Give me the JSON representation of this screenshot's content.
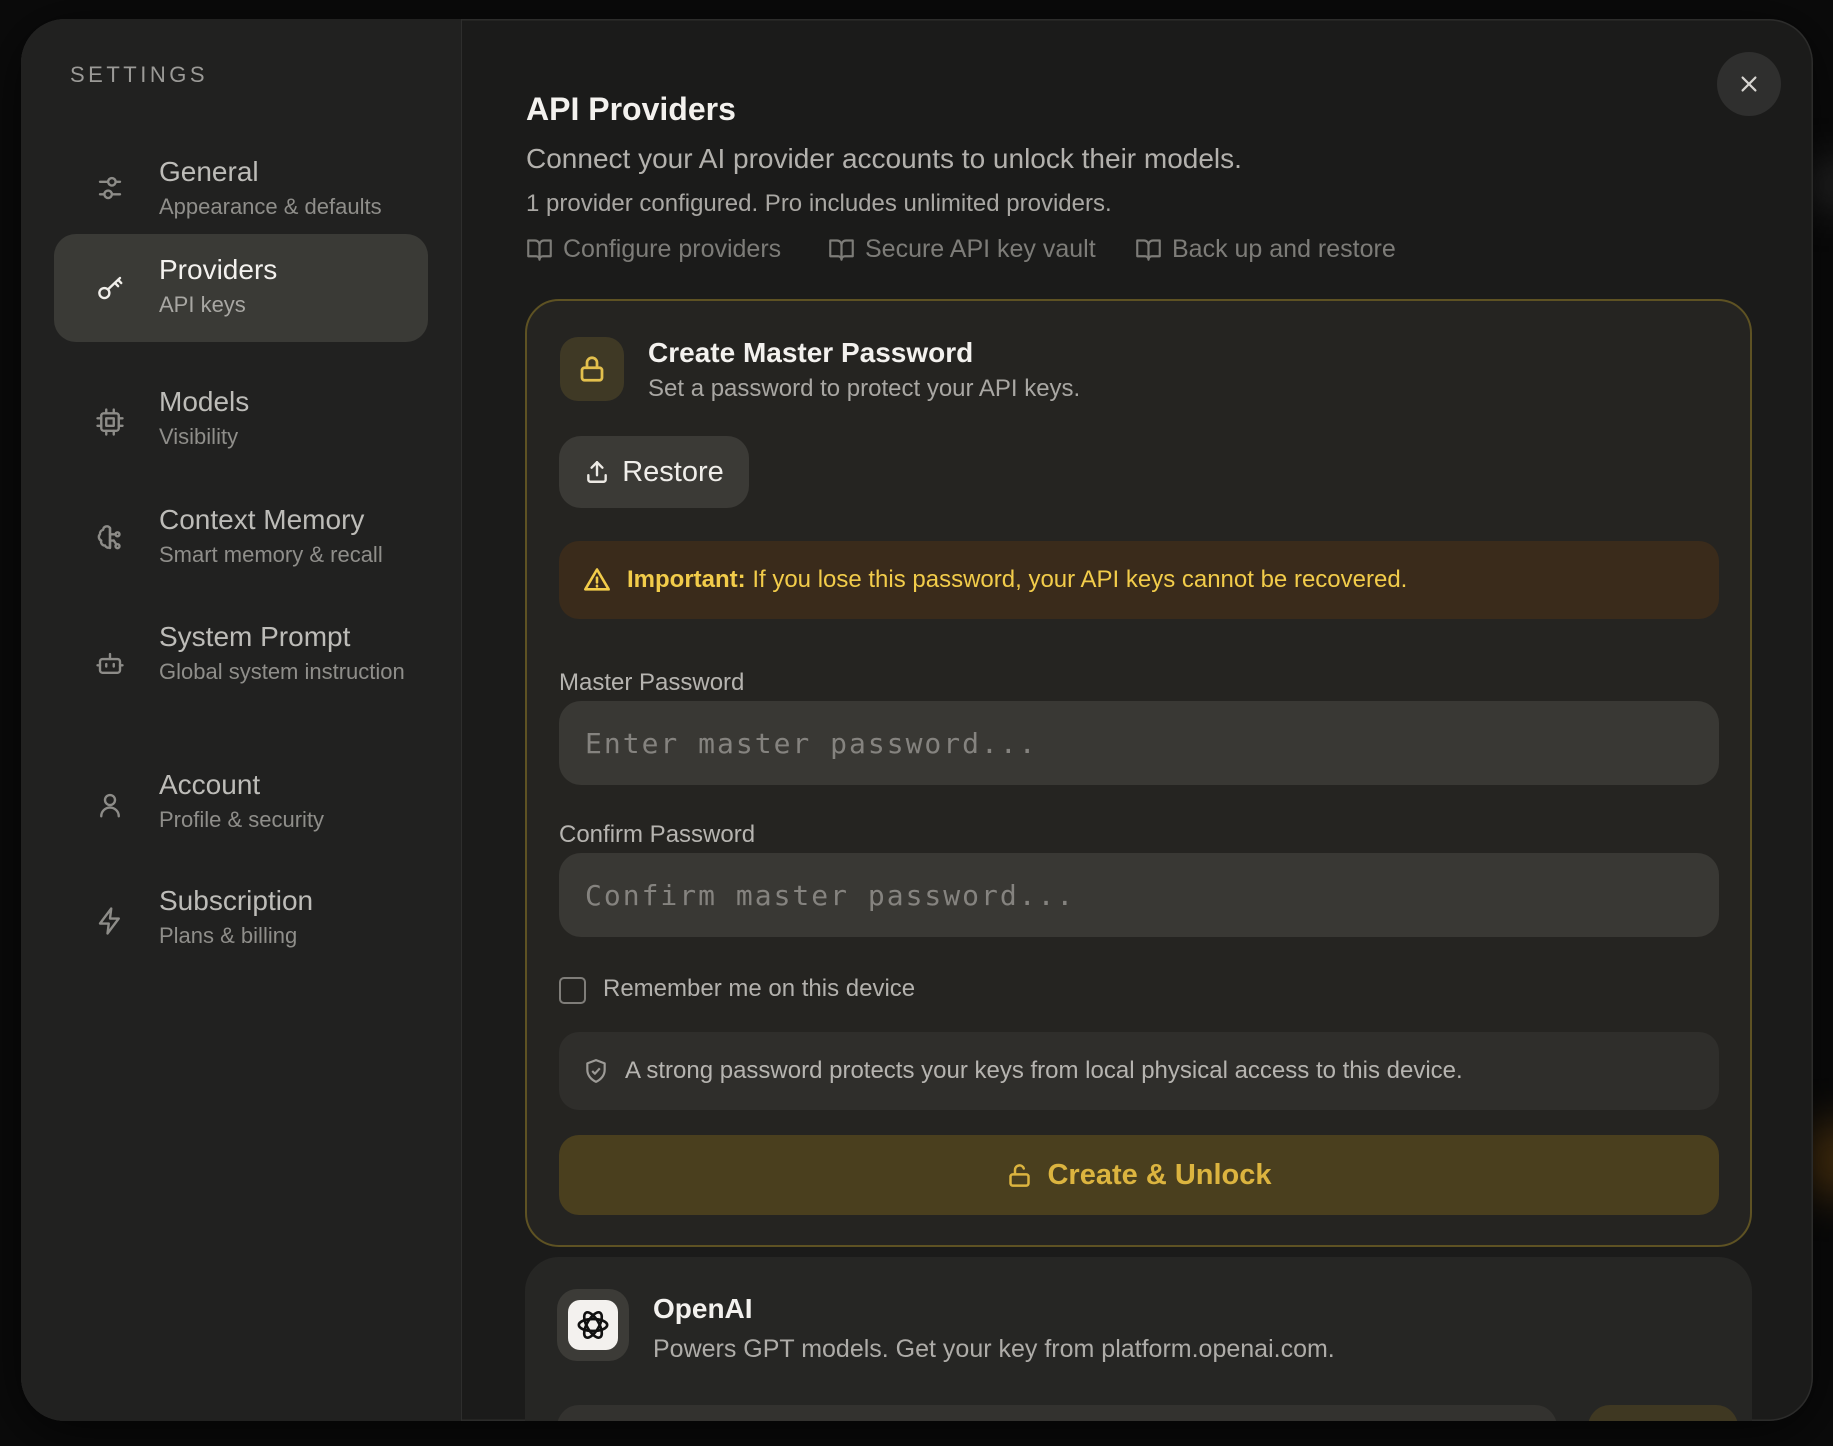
{
  "sidebar": {
    "heading": "SETTINGS",
    "items": [
      {
        "title": "General",
        "subtitle": "Appearance & defaults",
        "icon": "sliders-icon"
      },
      {
        "title": "Providers",
        "subtitle": "API keys",
        "icon": "key-icon",
        "active": true
      },
      {
        "title": "Models",
        "subtitle": "Visibility",
        "icon": "cpu-chip-icon"
      },
      {
        "title": "Context Memory",
        "subtitle": "Smart memory & recall",
        "icon": "brain-icon"
      },
      {
        "title": "System Prompt",
        "subtitle": "Global system instruction",
        "icon": "bot-icon"
      },
      {
        "title": "Account",
        "subtitle": "Profile & security",
        "icon": "user-icon"
      },
      {
        "title": "Subscription",
        "subtitle": "Plans & billing",
        "icon": "zap-icon"
      }
    ]
  },
  "header": {
    "title": "API Providers",
    "description": "Connect your AI provider accounts to unlock their models.",
    "status": "1 provider configured. Pro includes unlimited providers.",
    "doc_links": [
      "Configure providers",
      "Secure API key vault",
      "Back up and restore"
    ]
  },
  "master_password": {
    "title": "Create Master Password",
    "subtitle": "Set a password to protect your API keys.",
    "restore_label": "Restore",
    "warning_strong": "Important:",
    "warning_text": "If you lose this password, your API keys cannot be recovered.",
    "password_label": "Master Password",
    "password_placeholder": "Enter master password...",
    "confirm_label": "Confirm Password",
    "confirm_placeholder": "Confirm master password...",
    "remember_label": "Remember me on this device",
    "remember_checked": false,
    "info_text": "A strong password protects your keys from local physical access to this device.",
    "submit_label": "Create & Unlock"
  },
  "providers": [
    {
      "name": "OpenAI",
      "description": "Powers GPT models. Get your key from platform.openai.com.",
      "icon": "openai-logo-icon"
    }
  ],
  "colors": {
    "accent": "#e3c04d",
    "warning": "#f2cc4a",
    "background": "#1b1b1a",
    "active_nav": "#3a3a36"
  }
}
